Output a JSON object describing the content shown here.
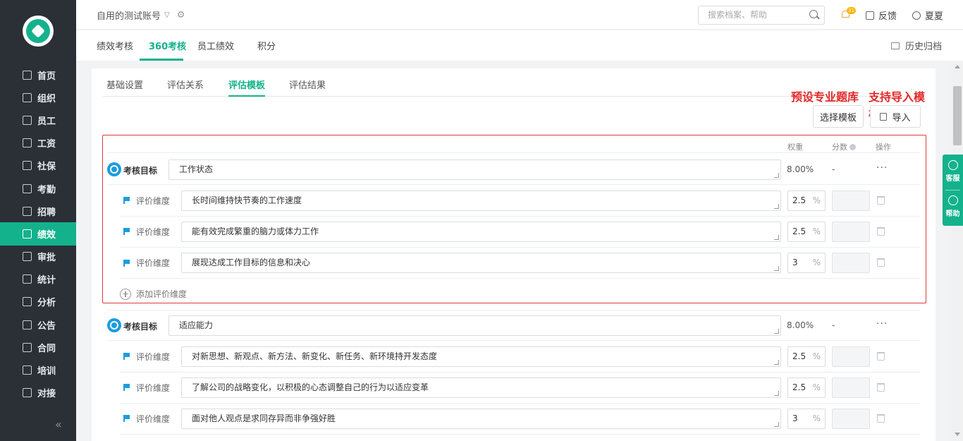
{
  "sidebar": {
    "logo": "app-logo",
    "items": [
      {
        "label": "首页",
        "icon": "home-icon",
        "active": false
      },
      {
        "label": "组织",
        "icon": "org-icon",
        "active": false
      },
      {
        "label": "员工",
        "icon": "employee-icon",
        "active": false
      },
      {
        "label": "工资",
        "icon": "salary-icon",
        "active": false
      },
      {
        "label": "社保",
        "icon": "shield-icon",
        "active": false
      },
      {
        "label": "考勤",
        "icon": "calendar-icon",
        "active": false
      },
      {
        "label": "招聘",
        "icon": "recruit-icon",
        "active": false
      },
      {
        "label": "绩效",
        "icon": "chart-icon",
        "active": true
      },
      {
        "label": "审批",
        "icon": "stamp-icon",
        "active": false
      },
      {
        "label": "统计",
        "icon": "stats-icon",
        "active": false
      },
      {
        "label": "分析",
        "icon": "analysis-icon",
        "active": false
      },
      {
        "label": "公告",
        "icon": "notice-icon",
        "active": false
      },
      {
        "label": "合同",
        "icon": "contract-icon",
        "active": false
      },
      {
        "label": "培训",
        "icon": "training-icon",
        "active": false
      },
      {
        "label": "对接",
        "icon": "link-icon",
        "active": false
      }
    ],
    "collapse_glyph": "«"
  },
  "header": {
    "account": "自用的测试账号",
    "search_placeholder": "搜索档案、帮助",
    "notification_badge": "31",
    "feedback": "反馈",
    "user": "夏夏"
  },
  "tabs": {
    "items": [
      "绩效考核",
      "360考核",
      "员工绩效",
      "积分"
    ],
    "active": "360考核",
    "archive": "历史归档"
  },
  "subtabs": {
    "items": [
      "基础设置",
      "评估关系",
      "评估模板",
      "评估结果"
    ],
    "active": "评估模板"
  },
  "annotations": {
    "preset": "预设专业题库",
    "import": "支持导入模板"
  },
  "buttons": {
    "select_template": "选择模板",
    "import": "导入"
  },
  "table_header": {
    "weight": "权重",
    "score": "分数",
    "action": "操作"
  },
  "goals": [
    {
      "label": "考核目标",
      "name": "工作状态",
      "weight": "8.00%",
      "score": "-",
      "more": "···",
      "dimensions": [
        {
          "label": "评价维度",
          "text": "长时间维持快节奏的工作速度",
          "weight": "2.5",
          "unit": "%"
        },
        {
          "label": "评价维度",
          "text": "能有效完成繁重的脑力或体力工作",
          "weight": "2.5",
          "unit": "%"
        },
        {
          "label": "评价维度",
          "text": "展现达成工作目标的信息和决心",
          "weight": "3",
          "unit": "%"
        }
      ],
      "add_label": "添加评价维度"
    },
    {
      "label": "考核目标",
      "name": "适应能力",
      "weight": "8.00%",
      "score": "-",
      "more": "···",
      "dimensions": [
        {
          "label": "评价维度",
          "text": "对新思想、新观点、新方法、新变化、新任务、新环境持开发态度",
          "weight": "2.5",
          "unit": "%"
        },
        {
          "label": "评价维度",
          "text": "了解公司的战略变化，以积极的心态调整自己的行为以适应变革",
          "weight": "2.5",
          "unit": "%"
        },
        {
          "label": "评价维度",
          "text": "面对他人观点是求同存异而非争强好胜",
          "weight": "3",
          "unit": "%"
        }
      ]
    }
  ],
  "float_service": {
    "service": "客服",
    "help": "帮助"
  },
  "colors": {
    "accent": "#13b28c",
    "sidebar_bg": "#2b2f36",
    "annotation_red": "#e32727",
    "goal_icon_blue": "#1a9de0"
  }
}
